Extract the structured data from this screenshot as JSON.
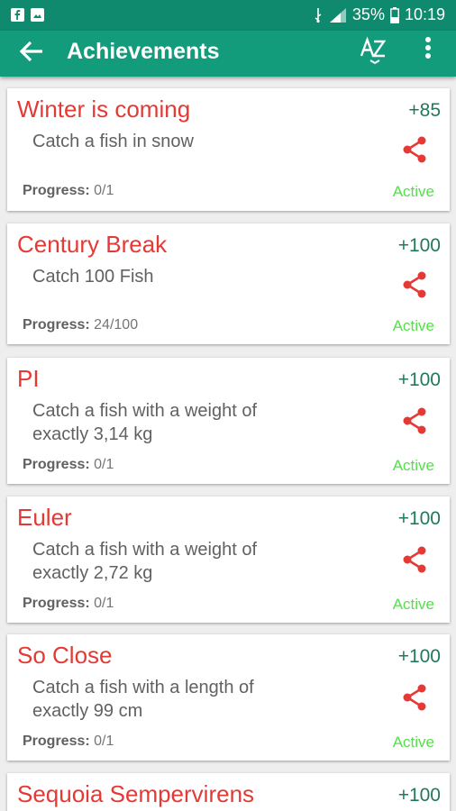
{
  "status_bar": {
    "battery": "35%",
    "time": "10:19"
  },
  "app_bar": {
    "title": "Achievements"
  },
  "achievements": [
    {
      "title": "Winter is coming",
      "points": "+85",
      "description": "Catch a fish in snow",
      "progress_label": "Progress:",
      "progress": "0/1",
      "status": "Active"
    },
    {
      "title": "Century Break",
      "points": "+100",
      "description": "Catch 100 Fish",
      "progress_label": "Progress:",
      "progress": "24/100",
      "status": "Active"
    },
    {
      "title": "PI",
      "points": "+100",
      "description": "Catch a fish with a weight of exactly 3,14 kg",
      "progress_label": "Progress:",
      "progress": "0/1",
      "status": "Active"
    },
    {
      "title": "Euler",
      "points": "+100",
      "description": "Catch a fish with a weight of exactly 2,72 kg",
      "progress_label": "Progress:",
      "progress": "0/1",
      "status": "Active"
    },
    {
      "title": "So Close",
      "points": "+100",
      "description": "Catch a fish with a length of exactly 99 cm",
      "progress_label": "Progress:",
      "progress": "0/1",
      "status": "Active"
    },
    {
      "title": "Sequoia Sempervirens",
      "points": "+100"
    }
  ],
  "colors": {
    "app_bar": "#139c7c",
    "status_bar": "#0f8a6e",
    "title": "#e53935",
    "points": "#1f7a5a",
    "active": "#54e04a"
  }
}
